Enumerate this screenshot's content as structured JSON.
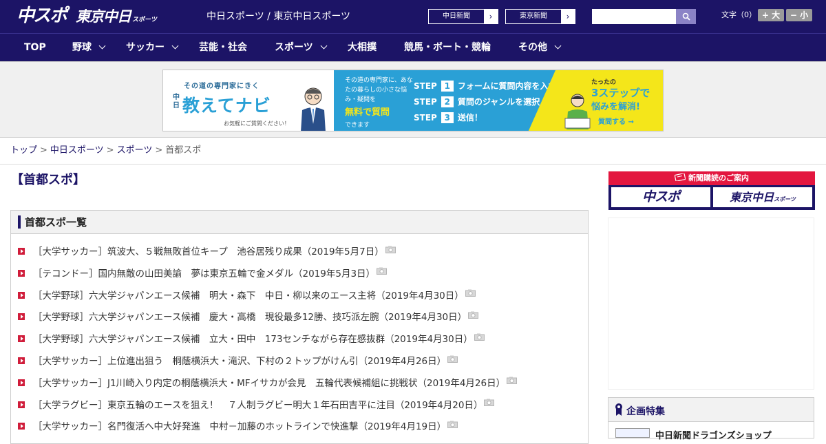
{
  "header": {
    "logo_primary": "中スポ",
    "logo_secondary": "東京中日",
    "logo_secondary_small": "スポーツ",
    "site_title": "中日スポーツ / 東京中日スポーツ",
    "paper_links": [
      {
        "label": "中日新聞",
        "arrow": "›"
      },
      {
        "label": "東京新聞",
        "arrow": "›"
      }
    ],
    "search": {
      "value": "",
      "placeholder": ""
    },
    "font_size": {
      "label": "文字（0）",
      "larger": "+ 大",
      "smaller": "− 小"
    }
  },
  "nav": {
    "items": [
      {
        "label": "TOP",
        "dropdown": false
      },
      {
        "label": "野球",
        "dropdown": true
      },
      {
        "label": "サッカー",
        "dropdown": true
      },
      {
        "label": "芸能・社会",
        "dropdown": false
      },
      {
        "label": "スポーツ",
        "dropdown": true
      },
      {
        "label": "大相撲",
        "dropdown": false
      },
      {
        "label": "競馬・ボート・競輪",
        "dropdown": false
      },
      {
        "label": "その他",
        "dropdown": true
      }
    ]
  },
  "banner": {
    "subtitle": "その道の専門家にきく",
    "prefix": "中日",
    "title": "教えてナビ",
    "small": "お気軽にご質問ください！",
    "desc": "その道の専門家に、あなたの暮らしの小さな悩み・疑問を",
    "free": "無料で質問",
    "desc2": "できます",
    "step_word": "STEP",
    "steps": [
      {
        "no": "1",
        "text": "フォームに質問内容を入力"
      },
      {
        "no": "2",
        "text": "質問のジャンルを選択"
      },
      {
        "no": "3",
        "text": "送信！"
      }
    ],
    "y_line1": "たったの",
    "y_line2": "3ステップで",
    "y_line3": "悩みを解消!",
    "y_button": "質問する →"
  },
  "breadcrumb": {
    "items": [
      "トップ",
      "中日スポーツ",
      "スポーツ"
    ],
    "current": "首都スポ",
    "sep": ">"
  },
  "main": {
    "page_title": "【首都スポ】",
    "list_title": "首都スポ一覧",
    "articles": [
      "［大学サッカー］筑波大、５戦無敗首位キープ　池谷居残り成果（2019年5月7日）",
      "［テコンドー］国内無敵の山田美諭　夢は東京五輪で金メダル（2019年5月3日）",
      "［大学野球］六大学ジャパンエース候補　明大・森下　中日・柳以来のエース主将（2019年4月30日）",
      "［大学野球］六大学ジャパンエース候補　慶大・高橋　現役最多12勝、技巧派左腕（2019年4月30日）",
      "［大学野球］六大学ジャパンエース候補　立大・田中　173センチながら存在感抜群（2019年4月30日）",
      "［大学サッカー］上位進出狙う　桐蔭横浜大・滝沢、下村の２トップがけん引（2019年4月26日）",
      "［大学サッカー］J1川崎入り内定の桐蔭横浜大・MFイサカが会見　五輪代表候補組に挑戦状（2019年4月26日）",
      "［大学ラグビー］東京五輪のエースを狙え！　７人制ラグビー明大１年石田吉平に注目（2019年4月20日）",
      "［大学サッカー］名門復活へ中大好発進　中村－加藤のホットラインで快進撃（2019年4月19日）"
    ]
  },
  "sidebar": {
    "subscribe_title": "新聞購読のご案内",
    "subscribe_logo1": "中スポ",
    "subscribe_logo2": "東京中日",
    "subscribe_logo2_small": "スポーツ",
    "feature_title": "企画特集",
    "feature_item": "中日新聞ドラゴンズショップ"
  },
  "colors": {
    "navy": "#1c1466",
    "accent_red": "#e3163f",
    "banner_blue": "#2aa0d6",
    "banner_yellow": "#f4e61a"
  }
}
